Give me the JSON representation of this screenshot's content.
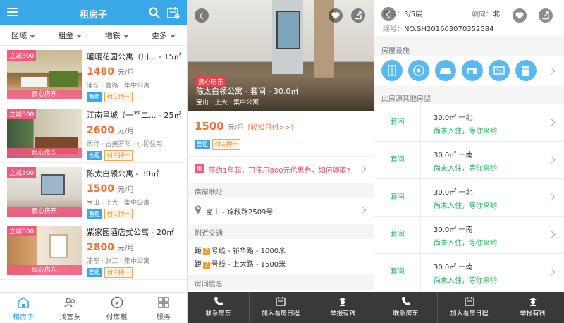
{
  "panel1": {
    "title": "租房子",
    "filters": [
      "区域",
      "租金",
      "地铁",
      "更多"
    ],
    "listings": [
      {
        "promo": "立减300",
        "name": "暖暖花园公寓（川...",
        "area": "15㎡",
        "price": "1480",
        "unit": "元/月",
        "location": "浦东 · 曹路 · 集中公寓",
        "tags": [
          "整租",
          "付三押一"
        ],
        "landlord": "良心房东"
      },
      {
        "promo": "立减500",
        "name": "江南星城（一至二...",
        "area": "25㎡",
        "price": "2600",
        "unit": "元/月",
        "location": "闵行 · 古美罗阳 · 小区住宅",
        "tags": [
          "合租",
          "付三押一"
        ],
        "landlord": "良心房东"
      },
      {
        "promo": "立减300",
        "name": "陈太白领公寓",
        "area": "30㎡",
        "price": "1500",
        "unit": "元/月",
        "location": "宝山 · 上大 · 集中公寓",
        "tags": [
          "整租",
          "付三押一"
        ],
        "landlord": "良心房东"
      },
      {
        "promo": "立减800",
        "name": "紫家园酒店式公寓",
        "area": "20㎡",
        "price": "2800",
        "unit": "元/月",
        "location": "浦东 · 张江 · 集中公寓",
        "tags": [
          "整租",
          "付三押一"
        ],
        "landlord": "良心房东"
      }
    ],
    "nav": [
      "租房子",
      "找室友",
      "付房租",
      "服务"
    ]
  },
  "panel2": {
    "badge": "良心房东",
    "title": "陈太白领公寓 - 套间 - 30.0㎡",
    "subtitle": "宝山 · 上大 · 集中公寓",
    "price": "1500",
    "unit": "元/月",
    "easy_pay": "[轻松月付>>]",
    "tags": [
      "整租",
      "付三押一"
    ],
    "coupon_badge": "惠",
    "coupon_text": "签约1年起，可使用800元优惠券，如何领取?",
    "address_header": "房屋地址",
    "address": "宝山 - 锦秋路2509号",
    "transit_header": "附近交通",
    "transit": [
      {
        "prefix": "距",
        "line": "7",
        "text": "号线 - 祁华路 - 1000米"
      },
      {
        "prefix": "距",
        "line": "7",
        "text": "号线 - 上大路 - 1500米"
      }
    ],
    "info_header": "房间信息"
  },
  "panel3": {
    "floor_label": "楼层：",
    "floor": "3/5层",
    "orient_label": "朝向：",
    "orient": "北",
    "code_label": "编号：",
    "code": "NO.SH201603070352584",
    "facilities_header": "房屋设施",
    "facilities": [
      "wardrobe-icon",
      "washer-icon",
      "sofa-icon",
      "desk-icon",
      "tv-icon",
      "fridge-icon"
    ],
    "other_header": "此房源其他房型",
    "rooms": [
      {
        "type": "套间",
        "spec": "30.0㎡ 一北",
        "status": "尚未入住，等你来哟"
      },
      {
        "type": "套间",
        "spec": "30.0㎡ 一南",
        "status": "尚未入住，等你来哟"
      },
      {
        "type": "套间",
        "spec": "30.0㎡ 一北",
        "status": "尚未入住，等你来哟"
      },
      {
        "type": "套间",
        "spec": "30.0㎡ 一南",
        "status": "尚未入住，等你来哟"
      },
      {
        "type": "套间",
        "spec": "30.0㎡ 一南",
        "status": "尚未入住，等你来哟"
      }
    ]
  },
  "actions": [
    "联系房东",
    "加入看房日程",
    "举报有钱"
  ],
  "colors": {
    "brand": "#3aa7e6",
    "price": "#f0733e",
    "promo": "#f05a7e",
    "green": "#2bb55e"
  }
}
